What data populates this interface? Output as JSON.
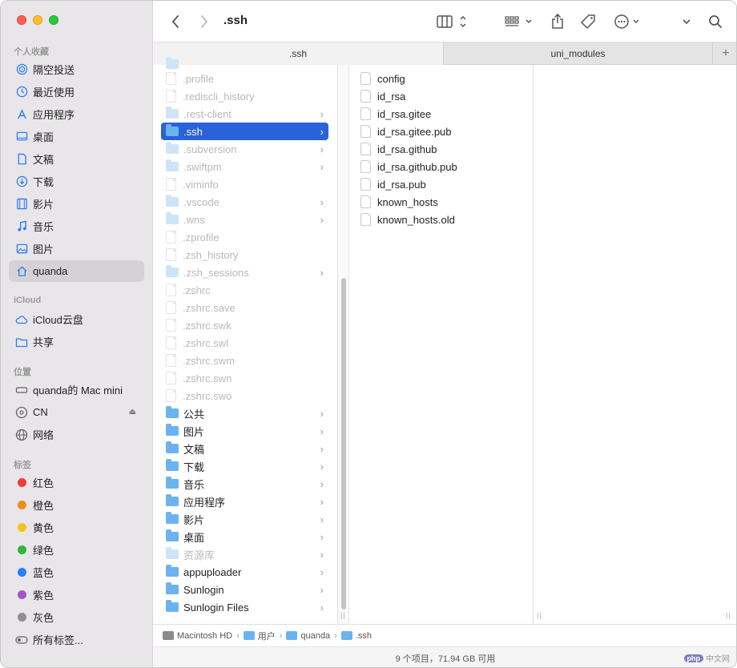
{
  "sidebar": {
    "favorites_title": "个人收藏",
    "favorites": [
      {
        "label": "隔空投送",
        "icon": "airdrop-icon"
      },
      {
        "label": "最近使用",
        "icon": "clock-icon"
      },
      {
        "label": "应用程序",
        "icon": "applications-icon"
      },
      {
        "label": "桌面",
        "icon": "desktop-icon"
      },
      {
        "label": "文稿",
        "icon": "document-icon"
      },
      {
        "label": "下载",
        "icon": "download-icon"
      },
      {
        "label": "影片",
        "icon": "film-icon"
      },
      {
        "label": "音乐",
        "icon": "music-icon"
      },
      {
        "label": "图片",
        "icon": "photo-icon"
      },
      {
        "label": "quanda",
        "icon": "home-icon"
      }
    ],
    "icloud_title": "iCloud",
    "icloud": [
      {
        "label": "iCloud云盘",
        "icon": "cloud-icon"
      },
      {
        "label": "共享",
        "icon": "shared-folder-icon"
      }
    ],
    "locations_title": "位置",
    "locations": [
      {
        "label": "quanda的 Mac mini",
        "icon": "computer-icon"
      },
      {
        "label": "CN",
        "icon": "disk-icon"
      },
      {
        "label": "网络",
        "icon": "network-icon"
      }
    ],
    "tags_title": "标签",
    "tags": [
      {
        "label": "红色",
        "color": "#ee3d3a"
      },
      {
        "label": "橙色",
        "color": "#f28b1d"
      },
      {
        "label": "黄色",
        "color": "#f4c31a"
      },
      {
        "label": "绿色",
        "color": "#31b53c"
      },
      {
        "label": "蓝色",
        "color": "#2a7ef6"
      },
      {
        "label": "紫色",
        "color": "#a553c9"
      },
      {
        "label": "灰色",
        "color": "#8e8e93"
      },
      {
        "label": "所有标签...",
        "color": ""
      }
    ]
  },
  "toolbar": {
    "title": ".ssh"
  },
  "tabs": {
    "active": ".ssh",
    "inactive": "uni_modules",
    "plus": "+"
  },
  "column1": [
    {
      "name": ".profile",
      "kind": "file",
      "dim": true,
      "chev": false
    },
    {
      "name": ".rediscli_history",
      "kind": "file",
      "dim": true,
      "chev": false
    },
    {
      "name": ".rest-client",
      "kind": "folder",
      "dim": true,
      "chev": true
    },
    {
      "name": ".ssh",
      "kind": "folder",
      "dim": false,
      "chev": true,
      "selected": true
    },
    {
      "name": ".subversion",
      "kind": "folder",
      "dim": true,
      "chev": true
    },
    {
      "name": ".swiftpm",
      "kind": "folder",
      "dim": true,
      "chev": true
    },
    {
      "name": ".viminfo",
      "kind": "file",
      "dim": true,
      "chev": false
    },
    {
      "name": ".vscode",
      "kind": "folder",
      "dim": true,
      "chev": true
    },
    {
      "name": ".wns",
      "kind": "folder",
      "dim": true,
      "chev": true
    },
    {
      "name": ".zprofile",
      "kind": "file",
      "dim": true,
      "chev": false
    },
    {
      "name": ".zsh_history",
      "kind": "file",
      "dim": true,
      "chev": false
    },
    {
      "name": ".zsh_sessions",
      "kind": "folder",
      "dim": true,
      "chev": true
    },
    {
      "name": ".zshrc",
      "kind": "file",
      "dim": true,
      "chev": false
    },
    {
      "name": ".zshrc.save",
      "kind": "file",
      "dim": true,
      "chev": false
    },
    {
      "name": ".zshrc.swk",
      "kind": "file",
      "dim": true,
      "chev": false
    },
    {
      "name": ".zshrc.swl",
      "kind": "file",
      "dim": true,
      "chev": false
    },
    {
      "name": ".zshrc.swm",
      "kind": "file",
      "dim": true,
      "chev": false
    },
    {
      "name": ".zshrc.swn",
      "kind": "file",
      "dim": true,
      "chev": false
    },
    {
      "name": ".zshrc.swo",
      "kind": "file",
      "dim": true,
      "chev": false
    },
    {
      "name": "公共",
      "kind": "folder",
      "dim": false,
      "chev": true
    },
    {
      "name": "图片",
      "kind": "folder",
      "dim": false,
      "chev": true
    },
    {
      "name": "文稿",
      "kind": "folder",
      "dim": false,
      "chev": true
    },
    {
      "name": "下载",
      "kind": "folder",
      "dim": false,
      "chev": true
    },
    {
      "name": "音乐",
      "kind": "folder",
      "dim": false,
      "chev": true
    },
    {
      "name": "应用程序",
      "kind": "folder",
      "dim": false,
      "chev": true
    },
    {
      "name": "影片",
      "kind": "folder",
      "dim": false,
      "chev": true
    },
    {
      "name": "桌面",
      "kind": "folder",
      "dim": false,
      "chev": true
    },
    {
      "name": "资源库",
      "kind": "folder",
      "dim": true,
      "chev": true
    },
    {
      "name": "appuploader",
      "kind": "folder",
      "dim": false,
      "chev": true
    },
    {
      "name": "Sunlogin",
      "kind": "folder",
      "dim": false,
      "chev": true
    },
    {
      "name": "Sunlogin Files",
      "kind": "folder",
      "dim": false,
      "chev": true
    }
  ],
  "column2": [
    {
      "name": "config"
    },
    {
      "name": "id_rsa"
    },
    {
      "name": "id_rsa.gitee"
    },
    {
      "name": "id_rsa.gitee.pub"
    },
    {
      "name": "id_rsa.github"
    },
    {
      "name": "id_rsa.github.pub"
    },
    {
      "name": "id_rsa.pub"
    },
    {
      "name": "known_hosts"
    },
    {
      "name": "known_hosts.old"
    }
  ],
  "pathbar": [
    {
      "label": "Macintosh HD",
      "color": "#8a8a8a"
    },
    {
      "label": "用户",
      "color": "#6bb3f0"
    },
    {
      "label": "quanda",
      "color": "#6bb3f0"
    },
    {
      "label": ".ssh",
      "color": "#6bb3f0"
    }
  ],
  "status": "9 个项目，71.94 GB 可用",
  "watermark": {
    "badge": "php",
    "text": "中文网"
  }
}
